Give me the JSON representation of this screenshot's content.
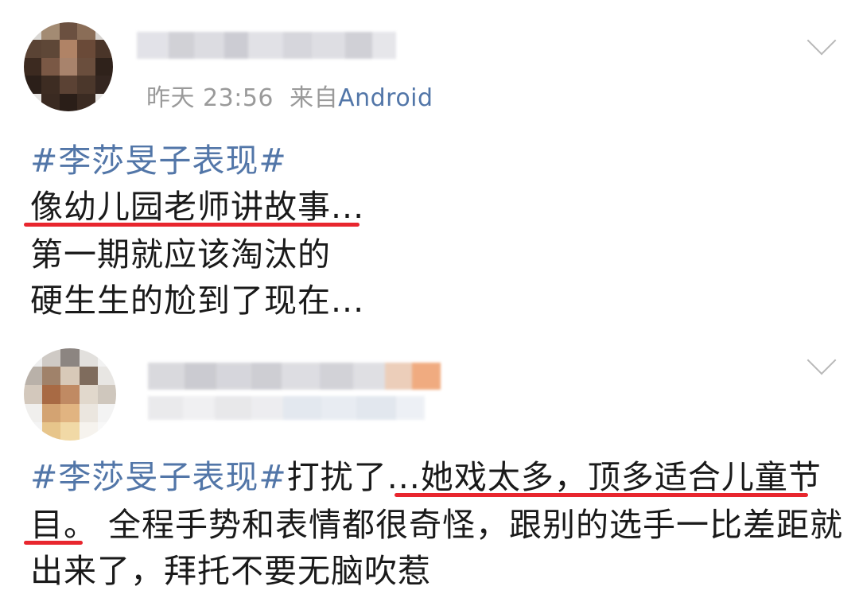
{
  "posts": [
    {
      "time": "昨天 23:56",
      "source_prefix": "来自",
      "source": "Android",
      "hashtag": "#李莎旻子表现#",
      "lines": [
        "像幼儿园老师讲故事...",
        "第一期就应该淘汰的",
        "硬生生的尬到了现在..."
      ]
    },
    {
      "hashtag": "#李莎旻子表现#",
      "line1_rest_a": "打扰了...",
      "line1_rest_b": "她戏太多，顶多适合儿童节",
      "line2_a": "目。",
      "line2_b": "全程手势和表情都很奇怪，跟别的选手一比差距就",
      "line3": "出来了，拜托不要无脑吹惹"
    }
  ],
  "colors": {
    "link": "#5276a8",
    "meta": "#9a9a9a",
    "underline": "#e8262e",
    "text": "#1a1a1a"
  }
}
